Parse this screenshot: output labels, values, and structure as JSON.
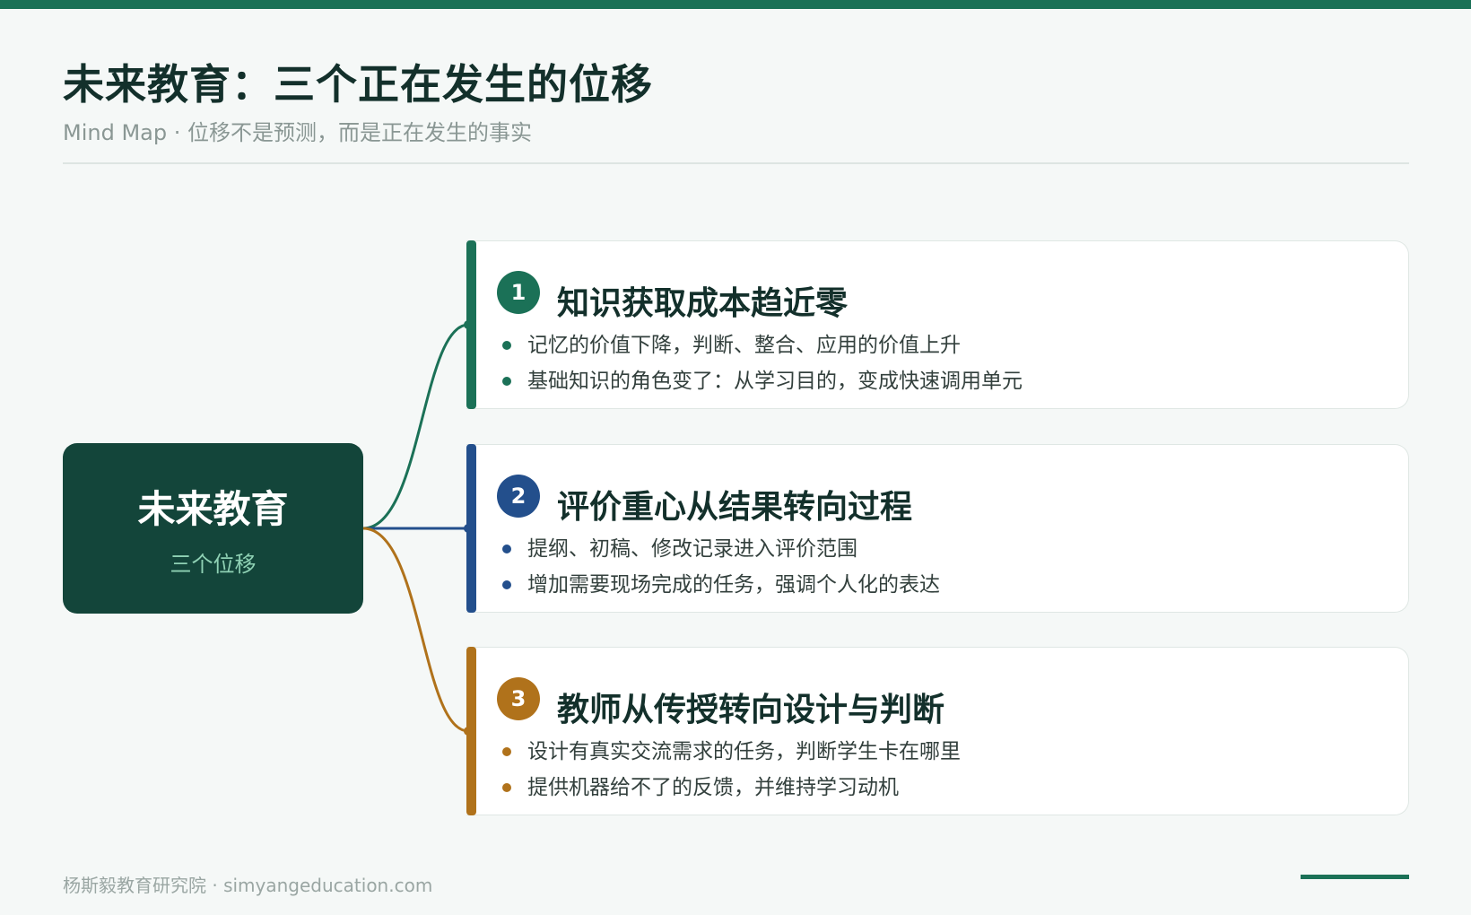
{
  "header": {
    "title": "未来教育：三个正在发生的位移",
    "subtitle": "Mind Map · 位移不是预测，而是正在发生的事实"
  },
  "center": {
    "title": "未来教育",
    "subtitle": "三个位移",
    "color": "#13453a"
  },
  "branches": [
    {
      "number": "1",
      "title": "知识获取成本趋近零",
      "color": "#1b7157",
      "points": [
        "记忆的价值下降，判断、整合、应用的价值上升",
        "基础知识的角色变了：从学习目的，变成快速调用单元"
      ]
    },
    {
      "number": "2",
      "title": "评价重心从结果转向过程",
      "color": "#234f8c",
      "points": [
        "提纲、初稿、修改记录进入评价范围",
        "增加需要现场完成的任务，强调个人化的表达"
      ]
    },
    {
      "number": "3",
      "title": "教师从传授转向设计与判断",
      "color": "#b0721b",
      "points": [
        "设计有真实交流需求的任务，判断学生卡在哪里",
        "提供机器给不了的反馈，并维持学习动机"
      ]
    }
  ],
  "footer": {
    "text": "杨斯毅教育研究院 · simyangeducation.com",
    "accent_color": "#1b7157"
  }
}
